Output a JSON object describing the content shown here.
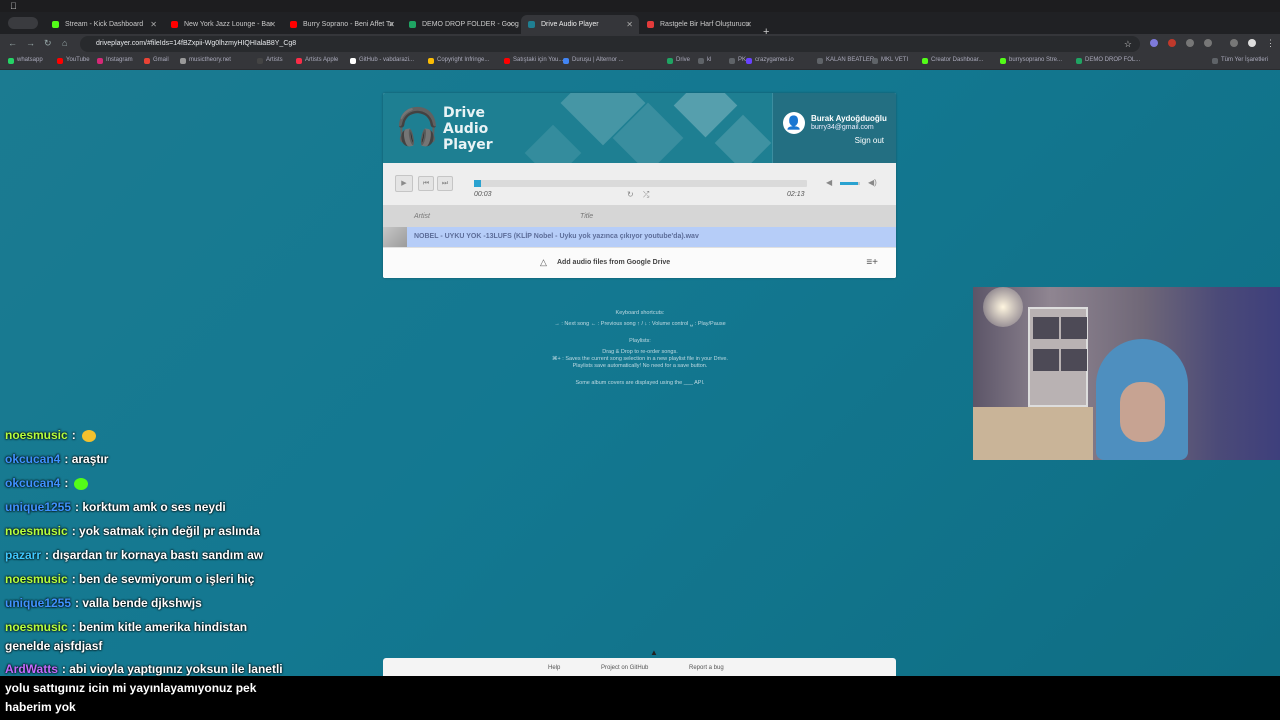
{
  "window": {
    "apple_glyph": ""
  },
  "tabs": [
    {
      "label": "Stream - Kick Dashboard",
      "color": "#53fc18"
    },
    {
      "label": "New York Jazz Lounge - Bar",
      "color": "#ff0000"
    },
    {
      "label": "Burry Soprano - Beni Affet Ta",
      "color": "#ff0000"
    },
    {
      "label": "DEMO DROP FOLDER - Goog",
      "color": "#1fa463"
    },
    {
      "label": "Drive Audio Player",
      "color": "#1f7f92"
    },
    {
      "label": "Rastgele Bir Harf Oluşturucu",
      "color": "#e33b3b"
    }
  ],
  "active_tab_index": 4,
  "new_tab_glyph": "+",
  "address_bar": {
    "url": "driveplayer.com/#fileIds=14fBZxpii-Wg0lhzmyHIQHIalaB8Y_Cg8"
  },
  "bookmarks": [
    {
      "label": "whatsapp",
      "color": "#25d366"
    },
    {
      "label": "YouTube",
      "color": "#ff0000"
    },
    {
      "label": "Instagram",
      "color": "#d62976"
    },
    {
      "label": "Gmail",
      "color": "#ea4335"
    },
    {
      "label": "musictheory.net",
      "color": "#999"
    },
    {
      "label": "Artists",
      "color": "#444"
    },
    {
      "label": "Artists Apple",
      "color": "#fa2d48"
    },
    {
      "label": "GitHub - vabdarazi...",
      "color": "#fff"
    },
    {
      "label": "Copyright Infringe...",
      "color": "#fbbc04"
    },
    {
      "label": "Satıştaki için You...",
      "color": "#ff0000"
    },
    {
      "label": "Duruşu | Alternor ...",
      "color": "#4285f4"
    },
    {
      "label": "Drive",
      "color": "#1fa463"
    },
    {
      "label": "kl",
      "color": "#5f6368"
    },
    {
      "label": "PK",
      "color": "#5f6368"
    },
    {
      "label": "crazygames.io",
      "color": "#6842ff"
    },
    {
      "label": "KALAN BEATLER",
      "color": "#5f6368"
    },
    {
      "label": "MKL VETI",
      "color": "#5f6368"
    },
    {
      "label": "Creator Dashboar...",
      "color": "#53fc18"
    },
    {
      "label": "burrysoprano Stre...",
      "color": "#53fc18"
    },
    {
      "label": "DEMO DROP FOL...",
      "color": "#1fa463"
    },
    {
      "label": "Tüm Yer İşaretleri",
      "color": "#5f6368"
    }
  ],
  "player": {
    "logo_lines": [
      "Drive",
      "Audio",
      "Player"
    ],
    "logo_icon": "🎧",
    "user_name": "Burak Aydoğduoğlu",
    "user_email": "burry34@gmail.com",
    "avatar_glyph": "👤",
    "sign_out": "Sign out",
    "time_current": "00:03",
    "time_total": "02:13",
    "progress_fraction": 0.02,
    "volume_fraction": 0.9,
    "columns": {
      "artist": "Artist",
      "title": "Title"
    },
    "track_title": "NOBEL - UYKU YOK -13LUFS (KLİP Nobel - Uyku yok yazınca çıkıyor youtube'da).wav",
    "add_label": "Add audio files from Google Drive",
    "playlist_glyph": "≡+",
    "play_glyph": "▶",
    "prev_glyph": "⏮",
    "next_glyph": "⏭",
    "repeat_glyph": "↻",
    "shuffle_glyph": "⤮",
    "mute_glyph": "◀",
    "vol_glyph": "◀)",
    "drive_glyph": "△",
    "accent": "#2aa2d0"
  },
  "shortcuts": {
    "heading": "Keyboard shortcuts:",
    "line1": "→ : Next song  ← : Previous song  ↑ / ↓ : Volume control  ␣ : Play/Pause",
    "playlists_heading": "Playlists:",
    "line2": "Drag & Drop to re-order songs.",
    "line3": "⌘+ : Saves the current song selection in a new playlist file in your Drive.",
    "line4": "Playlists save automatically! No need for a save button.",
    "line5": "Some album covers are displayed using the ___ API."
  },
  "footer": {
    "help": "Help",
    "github": "Project on GitHub",
    "bug": "Report a bug"
  },
  "chat": [
    {
      "user": "noesmusic",
      "color": "#b6ff3f",
      "text": ":",
      "emote": "#f2c12e"
    },
    {
      "user": "okcucan4",
      "color": "#3f92ff",
      "text": ": araştır"
    },
    {
      "user": "okcucan4",
      "color": "#3f92ff",
      "text": ":",
      "emote": "#53fc18"
    },
    {
      "user": "unique1255",
      "color": "#3f92ff",
      "text": ": korktum amk o ses neydi"
    },
    {
      "user": "noesmusic",
      "color": "#b6ff3f",
      "text": ": yok satmak için değil pr aslında"
    },
    {
      "user": "pazarr",
      "color": "#3fc9ff",
      "text": ": dışardan tır kornaya bastı sandım aw"
    },
    {
      "user": "noesmusic",
      "color": "#b6ff3f",
      "text": ": ben de sevmiyorum o işleri hiç"
    },
    {
      "user": "unique1255",
      "color": "#3f92ff",
      "text": ": valla bende djkshwjs"
    },
    {
      "user": "noesmusic",
      "color": "#b6ff3f",
      "text": ": benim kitle amerika hindistan genelde ajsfdjasf"
    },
    {
      "user": "ArdWatts",
      "color": "#c46bff",
      "text": ": abi vioyla yaptıgınız yoksun ile lanetli yolu sattıgınız icin mi yayınlayamıyonuz pek haberim yok"
    }
  ]
}
